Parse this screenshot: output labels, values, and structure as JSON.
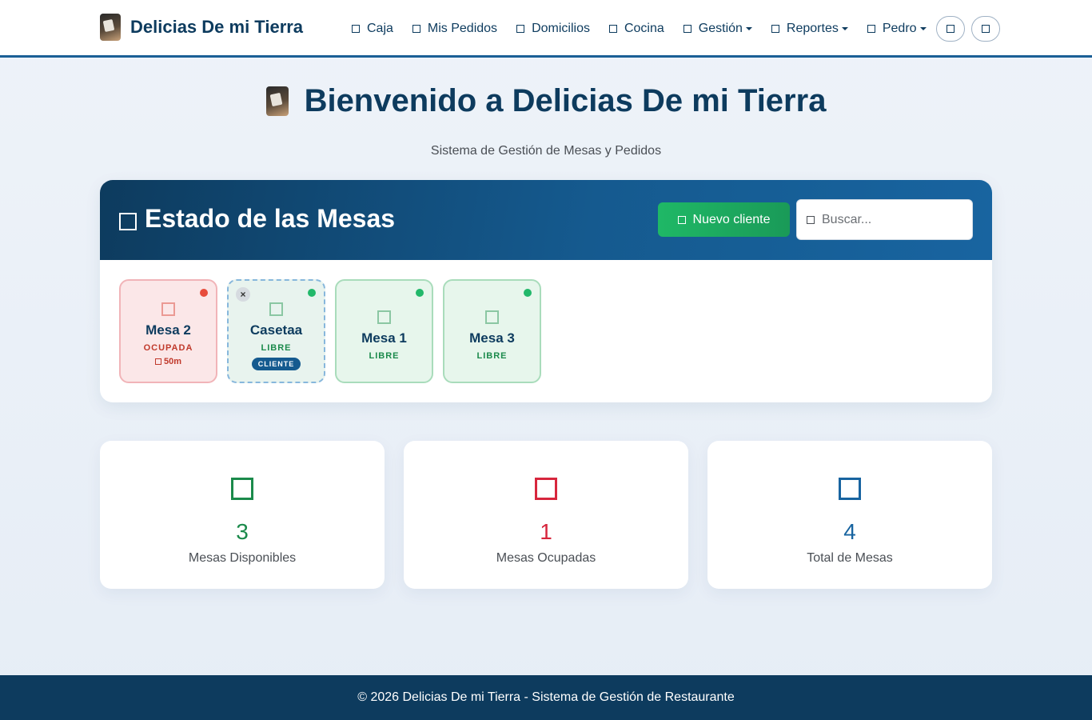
{
  "brand": {
    "name": "Delicias De mi Tierra"
  },
  "nav": {
    "items": [
      {
        "label": "Caja",
        "dropdown": false
      },
      {
        "label": "Mis Pedidos",
        "dropdown": false
      },
      {
        "label": "Domicilios",
        "dropdown": false
      },
      {
        "label": "Cocina",
        "dropdown": false
      },
      {
        "label": "Gestión",
        "dropdown": true
      },
      {
        "label": "Reportes",
        "dropdown": true
      },
      {
        "label": "Pedro",
        "dropdown": true
      }
    ]
  },
  "hero": {
    "title": "Bienvenido a Delicias De mi Tierra",
    "subtitle": "Sistema de Gestión de Mesas y Pedidos"
  },
  "mesas_panel": {
    "title": "Estado de las Mesas",
    "new_client_label": "Nuevo cliente",
    "search_placeholder": "Buscar...",
    "mesas": [
      {
        "name": "Mesa 2",
        "state": "OCUPADA",
        "time": "50m",
        "status_color": "#e74c3c"
      },
      {
        "name": "Casetaa",
        "state": "LIBRE",
        "badge": "CLIENTE",
        "status_color": "#22b86a"
      },
      {
        "name": "Mesa 1",
        "state": "LIBRE",
        "status_color": "#22b86a"
      },
      {
        "name": "Mesa 3",
        "state": "LIBRE",
        "status_color": "#22b86a"
      }
    ]
  },
  "stats": [
    {
      "value": "3",
      "label": "Mesas Disponibles",
      "color": "#1b8a4b"
    },
    {
      "value": "1",
      "label": "Mesas Ocupadas",
      "color": "#d7263d"
    },
    {
      "value": "4",
      "label": "Total de Mesas",
      "color": "#1864a0"
    }
  ],
  "footer": {
    "text": "© 2026 Delicias De mi Tierra - Sistema de Gestión de Restaurante"
  },
  "colors": {
    "primary": "#0d3b5e",
    "accent": "#1a5f96",
    "success": "#1fb866",
    "danger": "#e74c3c"
  }
}
